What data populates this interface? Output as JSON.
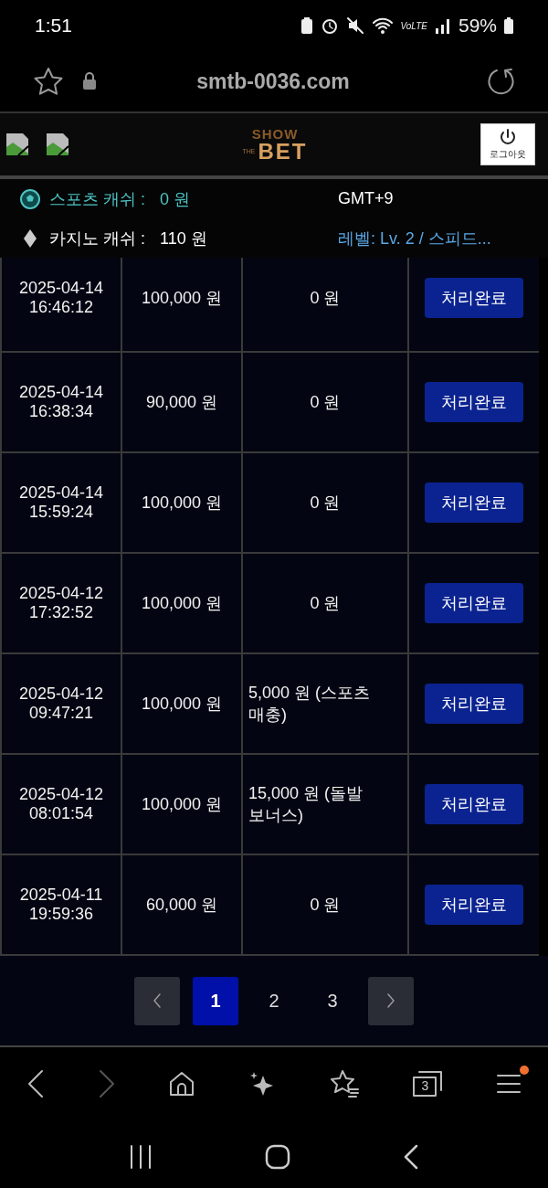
{
  "status_bar": {
    "time": "1:51",
    "network": "VoLTE",
    "battery": "59%"
  },
  "address_bar": {
    "url": "smtb-0036.com"
  },
  "site_header": {
    "logo": {
      "top": "SHOW",
      "small": "THE",
      "main": "BET"
    },
    "logout": "로그아웃"
  },
  "account": {
    "sports_label": "스포츠 캐쉬 :",
    "sports_value": "0 원",
    "casino_label": "카지노 캐쉬 :",
    "casino_value": "110 원",
    "timezone": "GMT+9",
    "level": "레벨: Lv. 2 / 스피드..."
  },
  "table": {
    "rows": [
      {
        "datetime": "2025-04-14 16:46:12",
        "amount": "100,000 원",
        "bonus": "0 원",
        "status": "처리완료"
      },
      {
        "datetime": "2025-04-14 16:38:34",
        "amount": "90,000 원",
        "bonus": "0 원",
        "status": "처리완료"
      },
      {
        "datetime": "2025-04-14 15:59:24",
        "amount": "100,000 원",
        "bonus": "0 원",
        "status": "처리완료"
      },
      {
        "datetime": "2025-04-12 17:32:52",
        "amount": "100,000 원",
        "bonus": "0 원",
        "status": "처리완료"
      },
      {
        "datetime": "2025-04-12 09:47:21",
        "amount": "100,000 원",
        "bonus": "5,000 원 (스포츠 매충)",
        "status": "처리완료"
      },
      {
        "datetime": "2025-04-12 08:01:54",
        "amount": "100,000 원",
        "bonus": "15,000 원 (돌발 보너스)",
        "status": "처리완료"
      },
      {
        "datetime": "2025-04-11 19:59:36",
        "amount": "60,000 원",
        "bonus": "0 원",
        "status": "처리완료"
      }
    ]
  },
  "pagination": {
    "pages": [
      {
        "label": "1",
        "selected": true
      },
      {
        "label": "2",
        "selected": false
      },
      {
        "label": "3",
        "selected": false
      }
    ]
  },
  "browser_toolbar": {
    "tab_count": "3",
    "menu_badge": true
  }
}
